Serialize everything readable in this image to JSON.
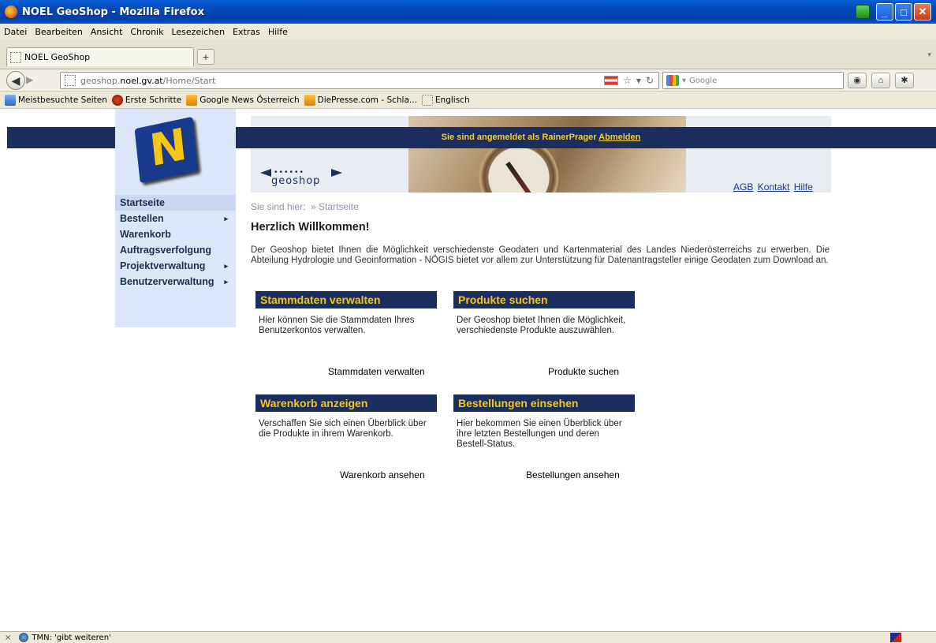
{
  "window": {
    "title": "NOEL GeoShop - Mozilla Firefox"
  },
  "menubar": [
    "Datei",
    "Bearbeiten",
    "Ansicht",
    "Chronik",
    "Lesezeichen",
    "Extras",
    "Hilfe"
  ],
  "tab": {
    "label": "NOEL GeoShop",
    "new_tab": "+"
  },
  "url": {
    "prefix": "geoshop.",
    "domain": "noel.gv.at",
    "path": "/Home/Start"
  },
  "search": {
    "placeholder": "Google"
  },
  "bookmarks": [
    {
      "label": "Meistbesuchte Seiten",
      "icon": "blue"
    },
    {
      "label": "Erste Schritte",
      "icon": "red"
    },
    {
      "label": "Google News Österreich",
      "icon": "rss"
    },
    {
      "label": "DiePresse.com - Schla...",
      "icon": "rss"
    },
    {
      "label": "Englisch",
      "icon": "page"
    }
  ],
  "page": {
    "login_message": "Sie sind angemeldet als RainerPrager",
    "logout_link": "Abmelden",
    "logo_text": "geoshop",
    "top_links": {
      "agb": "AGB",
      "kontakt": "Kontakt",
      "hilfe": "Hilfe"
    },
    "breadcrumb": {
      "prefix": "Sie sind hier:",
      "current": "» Startseite"
    },
    "heading": "Herzlich Willkommen!",
    "intro": "Der Geoshop bietet Ihnen die Möglichkeit verschiedenste Geodaten und Kartenmaterial des Landes Niederösterreichs zu erwerben. Die Abteilung Hydrologie und Geoinformation - NÖGIS bietet vor allem zur Unterstützung für Datenantragsteller einige Geodaten zum Download an.",
    "sidebar": [
      {
        "label": "Startseite",
        "arrow": false
      },
      {
        "label": "Bestellen",
        "arrow": true
      },
      {
        "label": "Warenkorb",
        "arrow": false
      },
      {
        "label": "Auftragsverfolgung",
        "arrow": false
      },
      {
        "label": "Projektverwaltung",
        "arrow": true
      },
      {
        "label": "Benutzerverwaltung",
        "arrow": true
      }
    ],
    "cards": {
      "stammdaten": {
        "title": "Stammdaten verwalten",
        "desc": "Hier können Sie die Stammdaten Ihres Benutzerkontos verwalten.",
        "link": "Stammdaten verwalten"
      },
      "produkte": {
        "title": "Produkte suchen",
        "desc": "Der Geoshop bietet Ihnen die Möglichkeit, verschiedenste Produkte auszuwählen.",
        "link": "Produkte suchen"
      },
      "warenkorb": {
        "title": "Warenkorb anzeigen",
        "desc": "Verschaffen Sie sich einen Überblick über die Produkte in ihrem Warenkorb.",
        "link": "Warenkorb ansehen"
      },
      "bestellungen": {
        "title": "Bestellungen einsehen",
        "desc": "Hier bekommen Sie einen Überblick über ihre letzten Bestellungen und deren Bestell-Status.",
        "link": "Bestellungen ansehen"
      }
    }
  },
  "statusbar": {
    "text": "TMN: 'gibt weiteren'",
    "close": "×"
  },
  "colors": {
    "navy": "#1b2e5e",
    "yellow": "#f5c518",
    "sidebar": "#dde6f8",
    "link": "#1d3595"
  }
}
